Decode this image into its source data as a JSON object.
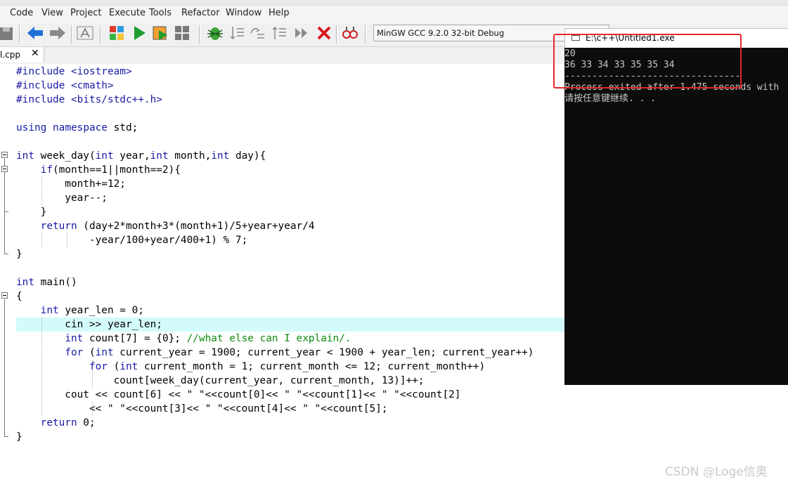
{
  "menu": [
    "Code",
    "View",
    "Project",
    "Execute",
    "Tools",
    "Refactor",
    "Window",
    "Help"
  ],
  "toolbar": {
    "compiler": "MinGW GCC 9.2.0 32-bit Debug",
    "icons": [
      "save-icon",
      "back-arrow-icon",
      "forward-arrow-icon",
      "format-source-icon",
      "compile-icon",
      "run-icon",
      "compile-run-icon",
      "rebuild-all-icon",
      "debug-icon",
      "step-into-icon",
      "step-over-icon",
      "step-out-icon",
      "continue-icon",
      "stop-icon",
      "profile-icon"
    ]
  },
  "tab": {
    "label": "l.cpp",
    "close": "✕"
  },
  "editor": {
    "highlight_line": 19,
    "lines": [
      "#include <iostream>",
      "#include <cmath>",
      "#include <bits/stdc++.h>",
      "",
      "using namespace std;",
      "",
      "int week_day(int year,int month,int day){",
      "    if(month==1||month==2){",
      "        month+=12;",
      "        year--;",
      "    }",
      "    return (day+2*month+3*(month+1)/5+year+year/4",
      "            -year/100+year/400+1) % 7;",
      "}",
      "",
      "int main()",
      "{",
      "    int year_len = 0;",
      "        cin >> year_len;",
      "        int count[7] = {0}; //what else can I explain/.",
      "        for (int current_year = 1900; current_year < 1900 + year_len; current_year++)",
      "            for (int current_month = 1; current_month <= 12; current_month++)",
      "                count[week_day(current_year, current_month, 13)]++;",
      "        cout << count[6] << \" \"<<count[0]<< \" \"<<count[1]<< \" \"<<count[2]",
      "            << \" \"<<count[3]<< \" \"<<count[4]<< \" \"<<count[5];",
      "    return 0;",
      "}"
    ]
  },
  "console": {
    "title": "E:\\c++\\Untitled1.exe",
    "lines": [
      "20",
      "36 33 34 33 35 35 34",
      "--------------------------------",
      "Process exited after 1.475 seconds with",
      "请按任意键继续. . ."
    ]
  },
  "watermark": "CSDN @Loge信奥"
}
